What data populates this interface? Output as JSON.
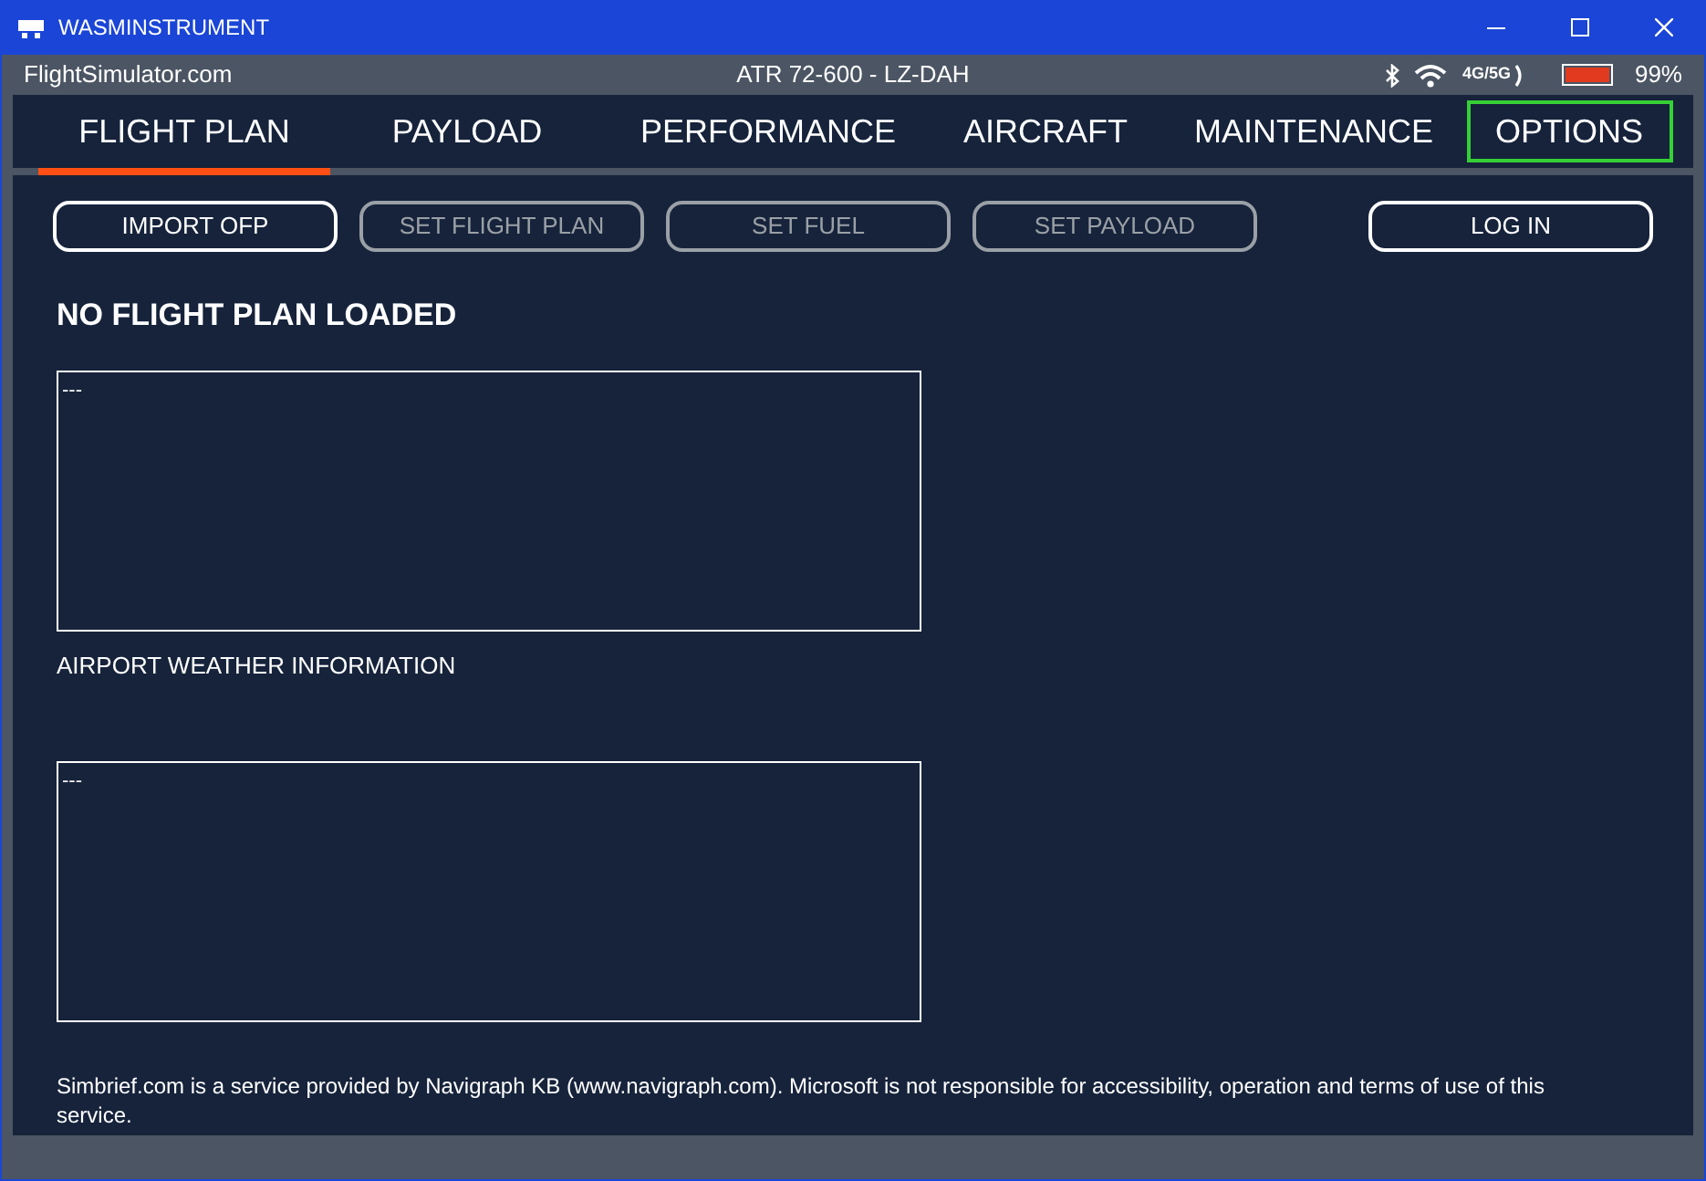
{
  "window": {
    "title": "WASMINSTRUMENT"
  },
  "status_bar": {
    "site": "FlightSimulator.com",
    "aircraft": "ATR 72-600 - LZ-DAH",
    "network": "4G/5G",
    "battery": "99%"
  },
  "tabs": [
    {
      "label": "FLIGHT PLAN",
      "selected": true,
      "focused": false
    },
    {
      "label": "PAYLOAD",
      "selected": false,
      "focused": false
    },
    {
      "label": "PERFORMANCE",
      "selected": false,
      "focused": false
    },
    {
      "label": "AIRCRAFT",
      "selected": false,
      "focused": false
    },
    {
      "label": "MAINTENANCE",
      "selected": false,
      "focused": false
    },
    {
      "label": "OPTIONS",
      "selected": false,
      "focused": true
    }
  ],
  "actions": [
    {
      "label": "IMPORT OFP",
      "disabled": false
    },
    {
      "label": "SET FLIGHT PLAN",
      "disabled": true
    },
    {
      "label": "SET FUEL",
      "disabled": true
    },
    {
      "label": "SET PAYLOAD",
      "disabled": true
    }
  ],
  "login_button": {
    "label": "LOG IN",
    "disabled": false
  },
  "heading": "NO FLIGHT PLAN LOADED",
  "flight_plan_box": {
    "value": "---"
  },
  "weather_label": "AIRPORT WEATHER INFORMATION",
  "weather_box": {
    "value": "---"
  },
  "footer_note": "Simbrief.com is a service provided by Navigraph KB (www.navigraph.com). Microsoft is not responsible for accessibility, operation and terms of use of this service."
}
